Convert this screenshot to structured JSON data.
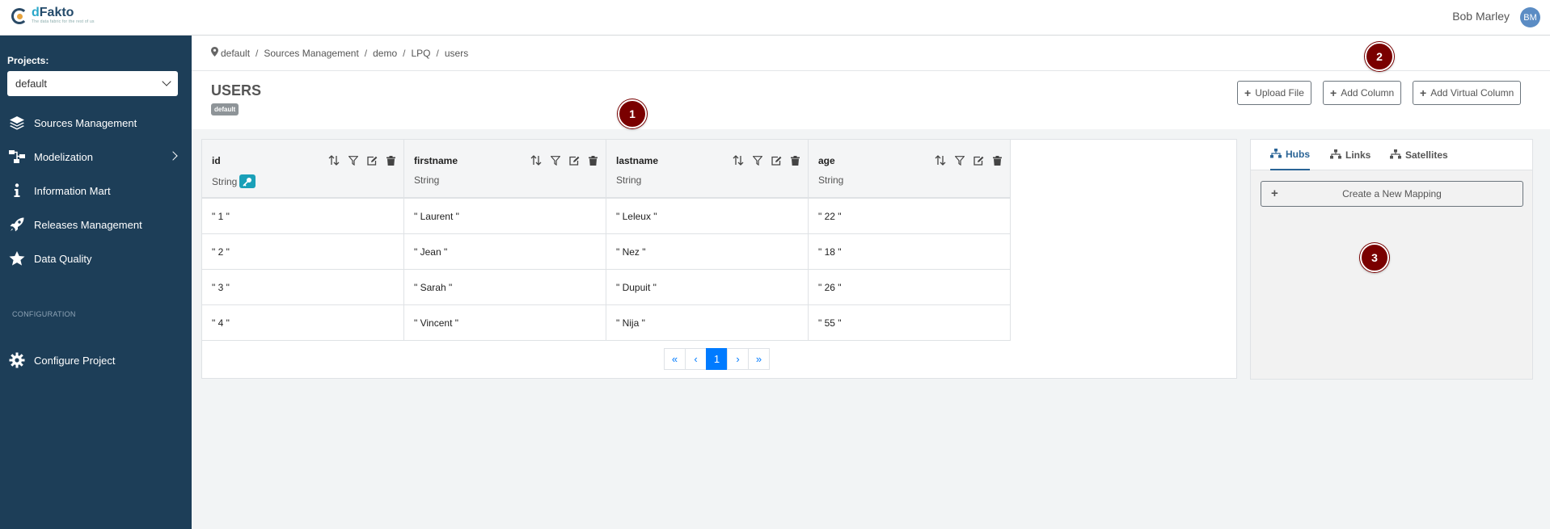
{
  "header": {
    "logo_name_d": "d",
    "logo_name_rest": "Fakto",
    "logo_tagline": "The data fabric for the rest of us",
    "user_name": "Bob Marley",
    "avatar_initials": "BM"
  },
  "sidebar": {
    "projects_label": "Projects:",
    "project_selected": "default",
    "items": [
      {
        "label": "Sources Management",
        "icon": "layers-icon"
      },
      {
        "label": "Modelization",
        "icon": "diagram-icon"
      },
      {
        "label": "Information Mart",
        "icon": "info-icon"
      },
      {
        "label": "Releases Management",
        "icon": "rocket-icon"
      },
      {
        "label": "Data Quality",
        "icon": "star-icon"
      }
    ],
    "config_label": "CONFIGURATION",
    "configure_project": "Configure Project",
    "bg_color": "#1d3e58"
  },
  "breadcrumb": [
    "default",
    "Sources Management",
    "demo",
    "LPQ",
    "users"
  ],
  "page": {
    "title": "USERS",
    "badge": "default"
  },
  "actions": {
    "upload_file": "Upload File",
    "add_column": "Add Column",
    "add_virtual_column": "Add Virtual Column"
  },
  "table": {
    "columns": [
      {
        "name": "id",
        "type": "String",
        "is_key": true
      },
      {
        "name": "firstname",
        "type": "String",
        "is_key": false
      },
      {
        "name": "lastname",
        "type": "String",
        "is_key": false
      },
      {
        "name": "age",
        "type": "String",
        "is_key": false
      }
    ],
    "rows": [
      [
        "\" 1 \"",
        "\" Laurent \"",
        "\" Leleux \"",
        "\" 22 \""
      ],
      [
        "\" 2 \"",
        "\" Jean \"",
        "\" Nez \"",
        "\" 18 \""
      ],
      [
        "\" 3 \"",
        "\" Sarah \"",
        "\" Dupuit \"",
        "\" 26 \""
      ],
      [
        "\" 4 \"",
        "\" Vincent \"",
        "\" Nija \"",
        "\" 55 \""
      ]
    ]
  },
  "pager": {
    "first": "«",
    "prev": "‹",
    "current": "1",
    "next": "›",
    "last": "»"
  },
  "mapping": {
    "tabs": [
      {
        "label": "Hubs",
        "active": true
      },
      {
        "label": "Links",
        "active": false
      },
      {
        "label": "Satellites",
        "active": false
      }
    ],
    "create_button": "Create a New Mapping"
  },
  "markers": [
    "1",
    "2",
    "3"
  ],
  "colors": {
    "accent": "#007bff",
    "key_badge": "#1aa0b8",
    "marker": "#7a0000"
  }
}
